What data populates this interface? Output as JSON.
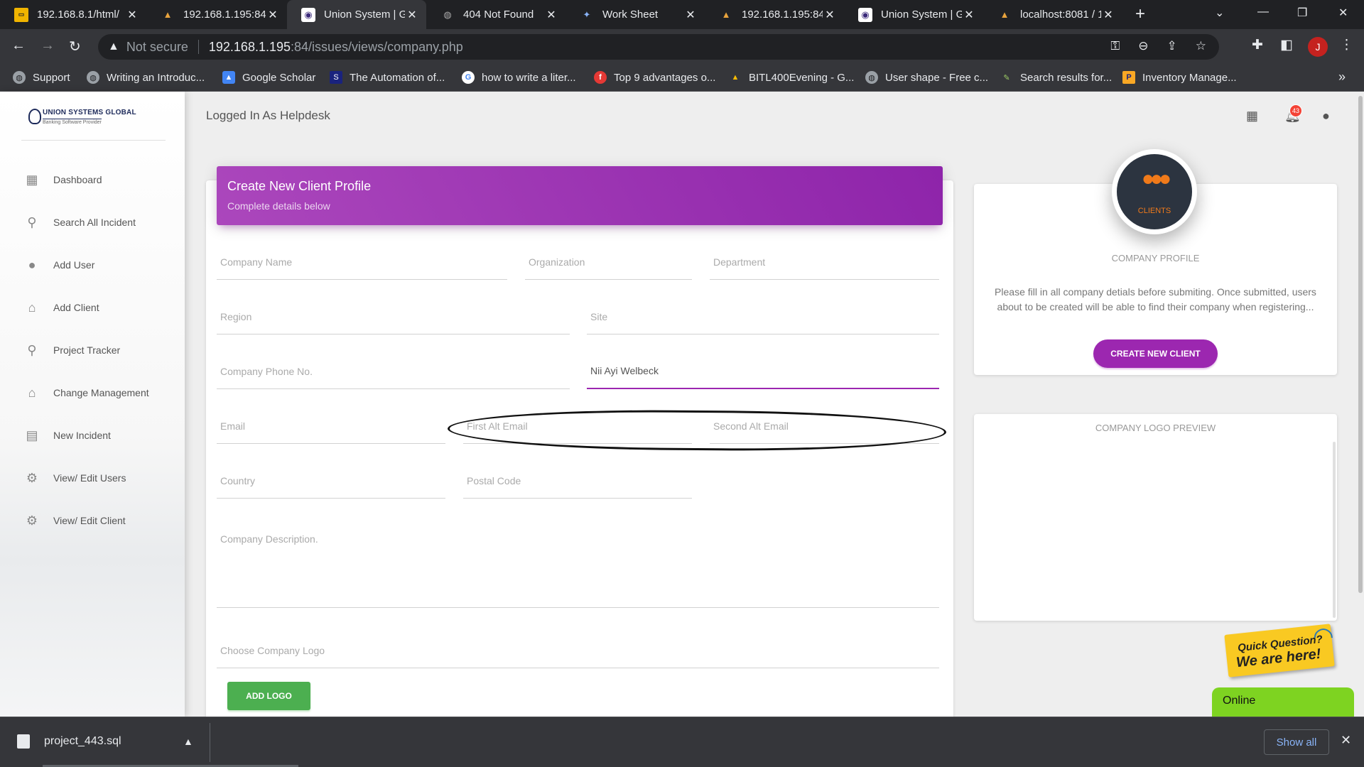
{
  "browser": {
    "tabs": [
      {
        "title": "192.168.8.1/html/",
        "icon": "folder-icon",
        "active": false
      },
      {
        "title": "192.168.1.195:84",
        "icon": "mountain-icon",
        "active": false
      },
      {
        "title": "Union System | Gl",
        "icon": "union-logo-icon",
        "active": true
      },
      {
        "title": "404 Not Found",
        "icon": "globe-icon",
        "active": false
      },
      {
        "title": "Work Sheet",
        "icon": "worksheet-icon",
        "active": false
      },
      {
        "title": "192.168.1.195:84",
        "icon": "mountain-icon",
        "active": false
      },
      {
        "title": "Union System | Gl",
        "icon": "union-logo-icon",
        "active": false
      },
      {
        "title": "localhost:8081 / 1",
        "icon": "mountain-icon",
        "active": false
      }
    ],
    "address": {
      "security": "Not secure",
      "host": "192.168.1.195",
      "path": ":84/issues/views/company.php"
    },
    "profile_initial": "J",
    "bookmarks": [
      {
        "label": "Support",
        "icon": "globe-icon",
        "color": "#9aa0a6"
      },
      {
        "label": "Writing an Introduc...",
        "icon": "globe-icon",
        "color": "#9aa0a6"
      },
      {
        "label": "Google Scholar",
        "icon": "scholar-icon",
        "color": "#4285f4"
      },
      {
        "label": "The Automation of...",
        "icon": "ssrn-icon",
        "color": "#1a237e"
      },
      {
        "label": "how to write a liter...",
        "icon": "google-icon",
        "color": "#ffffff"
      },
      {
        "label": "Top 9 advantages o...",
        "icon": "f-icon",
        "color": "#e53935"
      },
      {
        "label": "BITL400Evening - G...",
        "icon": "drive-icon",
        "color": "#fbbc04"
      },
      {
        "label": "User shape - Free c...",
        "icon": "globe-icon",
        "color": "#9aa0a6"
      },
      {
        "label": "Search results for...",
        "icon": "pen-icon",
        "color": "#9ccc65"
      },
      {
        "label": "Inventory Manage...",
        "icon": "p-icon",
        "color": "#f9a825"
      }
    ],
    "download": {
      "filename": "project_443.sql",
      "show_all": "Show all"
    }
  },
  "app": {
    "logo": {
      "name": "UNION SYSTEMS GLOBAL",
      "tagline": "Banking Software Provider"
    },
    "nav": [
      {
        "label": "Dashboard",
        "icon": "dashboard-icon"
      },
      {
        "label": "Search All Incident",
        "icon": "search-icon"
      },
      {
        "label": "Add User",
        "icon": "person-icon"
      },
      {
        "label": "Add Client",
        "icon": "home-icon"
      },
      {
        "label": "Project Tracker",
        "icon": "search-icon"
      },
      {
        "label": "Change Management",
        "icon": "home-icon"
      },
      {
        "label": "New Incident",
        "icon": "clipboard-icon"
      },
      {
        "label": "View/ Edit Users",
        "icon": "gear-icon"
      },
      {
        "label": "View/ Edit Client",
        "icon": "gear-icon"
      }
    ],
    "topbar": {
      "title": "Logged In As Helpdesk",
      "notification_count": "43"
    },
    "form": {
      "title": "Create New Client Profile",
      "subtitle": "Complete details below",
      "fields": {
        "company_name": {
          "label": "Company Name",
          "value": ""
        },
        "organization": {
          "label": "Organization",
          "value": ""
        },
        "department": {
          "label": "Department",
          "value": ""
        },
        "region": {
          "label": "Region",
          "value": ""
        },
        "site": {
          "label": "Site",
          "value": ""
        },
        "phone": {
          "label": "Company Phone No.",
          "value": ""
        },
        "contact": {
          "label": "",
          "value": "Nii Ayi Welbeck"
        },
        "email": {
          "label": "Email",
          "value": ""
        },
        "first_alt_email": {
          "label": "First Alt Email",
          "value": ""
        },
        "second_alt_email": {
          "label": "Second Alt Email",
          "value": ""
        },
        "country": {
          "label": "Country",
          "value": ""
        },
        "postal_code": {
          "label": "Postal Code",
          "value": ""
        },
        "description": {
          "label": "Company Description.",
          "value": ""
        },
        "logo": {
          "label": "Choose Company Logo",
          "value": ""
        }
      },
      "add_logo_button": "ADD LOGO"
    },
    "profile_card": {
      "avatar_label": "CLIENTS",
      "category": "COMPANY PROFILE",
      "description": "Please fill in all company detials before submiting. Once submitted, users about to be created will be able to find their company when registering...",
      "button": "CREATE NEW CLIENT"
    },
    "preview_card": {
      "title": "COMPANY LOGO PREVIEW"
    },
    "chat": {
      "line1": "Quick Question?",
      "line2": "We are here!",
      "status": "Online"
    }
  },
  "colors": {
    "accent_purple": "#9c27b0",
    "green_button": "#4caf50",
    "online_green": "#7ed321"
  }
}
